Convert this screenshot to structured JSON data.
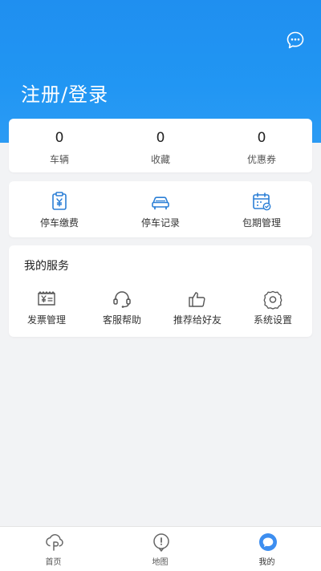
{
  "header": {
    "login_label": "注册/登录",
    "message_icon": "chat-bubble-icon"
  },
  "stats": [
    {
      "value": "0",
      "label": "车辆"
    },
    {
      "value": "0",
      "label": "收藏"
    },
    {
      "value": "0",
      "label": "优惠券"
    }
  ],
  "quick_actions": [
    {
      "label": "停车缴费",
      "icon": "parking-payment-icon"
    },
    {
      "label": "停车记录",
      "icon": "car-icon"
    },
    {
      "label": "包期管理",
      "icon": "calendar-icon"
    }
  ],
  "services": {
    "title": "我的服务",
    "items": [
      {
        "label": "发票管理",
        "icon": "invoice-icon"
      },
      {
        "label": "客服帮助",
        "icon": "headset-icon"
      },
      {
        "label": "推荐给好友",
        "icon": "thumbs-up-icon"
      },
      {
        "label": "系统设置",
        "icon": "settings-icon"
      }
    ]
  },
  "tabbar": {
    "tabs": [
      {
        "label": "首页",
        "icon": "home-p-icon"
      },
      {
        "label": "地图",
        "icon": "map-pin-icon"
      },
      {
        "label": "我的",
        "icon": "profile-bubble-icon"
      }
    ],
    "active_index": 2
  },
  "colors": {
    "primary": "#2196F3",
    "background": "#F2F3F5",
    "icon_blue": "#2B7FD6"
  }
}
